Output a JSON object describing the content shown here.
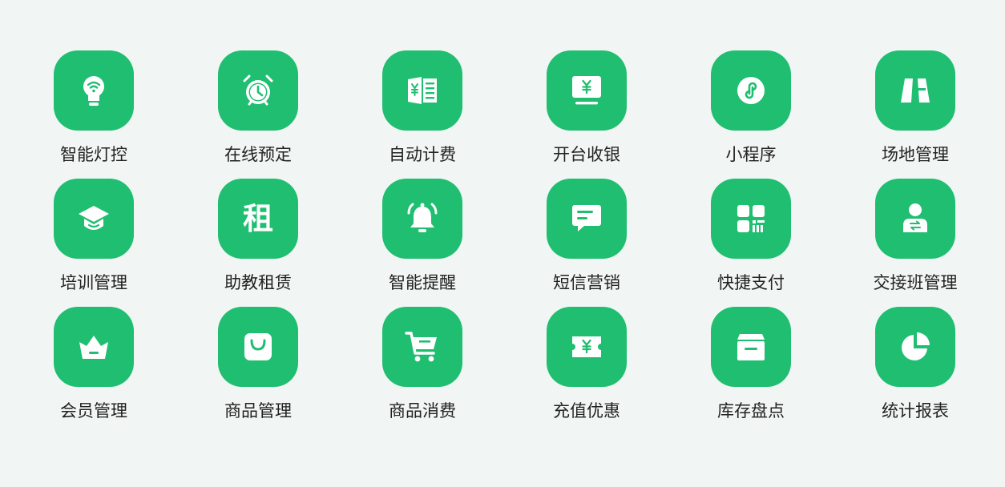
{
  "accent_color": "#1fbe71",
  "background_color": "#f1f6f4",
  "features": [
    {
      "id": "smart-light",
      "label": "智能灯控",
      "icon": "lightbulb-wifi-icon"
    },
    {
      "id": "online-booking",
      "label": "在线预定",
      "icon": "alarm-clock-icon"
    },
    {
      "id": "auto-billing",
      "label": "自动计费",
      "icon": "billing-book-icon"
    },
    {
      "id": "checkout",
      "label": "开台收银",
      "icon": "cashier-monitor-icon"
    },
    {
      "id": "mini-program",
      "label": "小程序",
      "icon": "mini-program-icon"
    },
    {
      "id": "venue-management",
      "label": "场地管理",
      "icon": "venue-icon"
    },
    {
      "id": "training-management",
      "label": "培训管理",
      "icon": "graduation-cap-icon"
    },
    {
      "id": "coach-rental",
      "label": "助教租赁",
      "icon": "rent-char-icon",
      "glyph": "租"
    },
    {
      "id": "smart-reminder",
      "label": "智能提醒",
      "icon": "bell-icon"
    },
    {
      "id": "sms-marketing",
      "label": "短信营销",
      "icon": "message-icon"
    },
    {
      "id": "quick-pay",
      "label": "快捷支付",
      "icon": "qr-code-icon"
    },
    {
      "id": "shift-handover",
      "label": "交接班管理",
      "icon": "user-swap-icon"
    },
    {
      "id": "member-management",
      "label": "会员管理",
      "icon": "crown-basket-icon"
    },
    {
      "id": "product-management",
      "label": "商品管理",
      "icon": "shopping-bag-icon"
    },
    {
      "id": "product-consumption",
      "label": "商品消费",
      "icon": "shopping-cart-icon"
    },
    {
      "id": "recharge-offers",
      "label": "充值优惠",
      "icon": "coupon-icon"
    },
    {
      "id": "inventory",
      "label": "库存盘点",
      "icon": "archive-box-icon"
    },
    {
      "id": "statistics",
      "label": "统计报表",
      "icon": "pie-chart-icon"
    }
  ]
}
